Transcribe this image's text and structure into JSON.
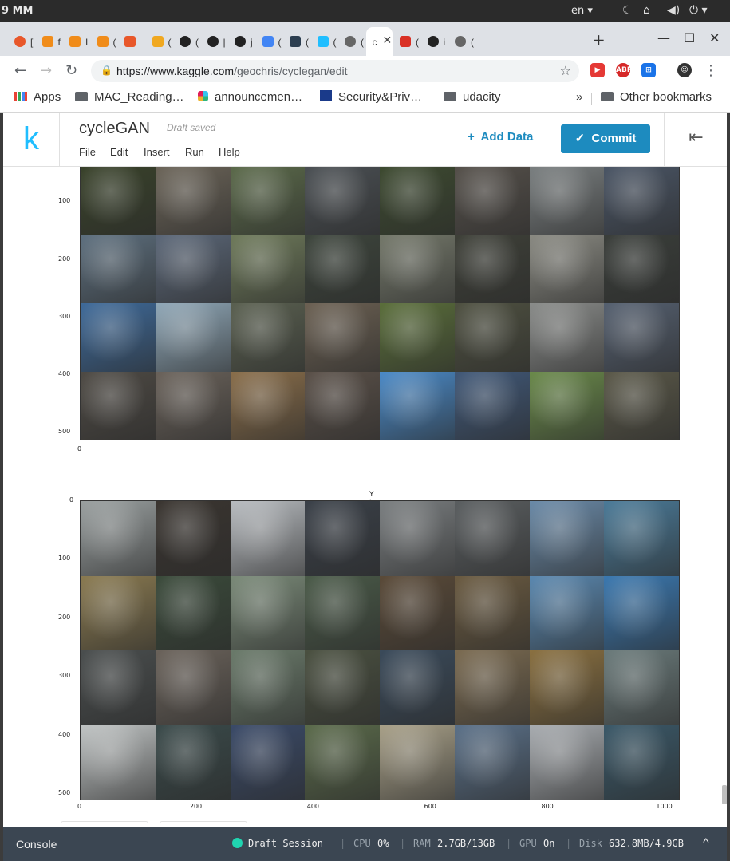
{
  "os": {
    "clock": "9 MM",
    "lang": "en",
    "icons": [
      "moon-icon",
      "network-icon",
      "volume-icon",
      "power-icon"
    ]
  },
  "browser": {
    "tabs": [
      {
        "icon": "chrome-ring-icon",
        "text": "[",
        "color": "#e8572a"
      },
      {
        "icon": "book-icon",
        "text": "f",
        "color": "#f08c1a"
      },
      {
        "icon": "book-icon",
        "text": "I",
        "color": "#f08c1a"
      },
      {
        "icon": "book-icon",
        "text": "(",
        "color": "#f08c1a"
      },
      {
        "icon": "flame-icon",
        "text": "",
        "color": "#e8572a"
      },
      {
        "icon": "infinity-icon",
        "text": "(",
        "color": "#f0a820"
      },
      {
        "icon": "github-icon",
        "text": "(",
        "color": "#222222"
      },
      {
        "icon": "github-icon",
        "text": "|",
        "color": "#222222"
      },
      {
        "icon": "github-icon",
        "text": "j",
        "color": "#222222"
      },
      {
        "icon": "translate-icon",
        "text": "(",
        "color": "#4285f4"
      },
      {
        "icon": "kaggle-dark-icon",
        "text": "(",
        "color": "#2c3e50"
      },
      {
        "icon": "kaggle-icon",
        "text": "(",
        "color": "#20beff"
      },
      {
        "icon": "globe-icon",
        "text": "(",
        "color": "#666666"
      },
      {
        "icon": "active-tab",
        "text": "c",
        "color": "#ffffff"
      },
      {
        "icon": "gmail-icon",
        "text": "(",
        "color": "#d93025"
      },
      {
        "icon": "github-icon",
        "text": "i",
        "color": "#222222"
      },
      {
        "icon": "globe-icon",
        "text": "(",
        "color": "#666666"
      }
    ],
    "url_host": "https://www.kaggle.com",
    "url_path": "/geochris/cyclegan/edit",
    "bookmarks": [
      "Apps",
      "MAC_Reading…",
      "announcemen…",
      "Security&Priv…",
      "udacity"
    ],
    "bookmarks_more": "»",
    "other_bookmarks": "Other bookmarks",
    "extensions": [
      {
        "label": "▶",
        "color": "#e53935"
      },
      {
        "label": "ABP",
        "color": "#d62828"
      },
      {
        "label": "⊞",
        "color": "#1a73e8"
      },
      {
        "label": "☺",
        "color": "#333333"
      }
    ]
  },
  "kaggle": {
    "logo": "k",
    "title": "cycleGAN",
    "status": "Draft saved",
    "menu": [
      "File",
      "Edit",
      "Insert",
      "Run",
      "Help"
    ],
    "add_data": "Add Data",
    "commit": "Commit"
  },
  "plots": [
    {
      "title": "",
      "y_ticks": [
        "100",
        "200",
        "300",
        "400",
        "500"
      ],
      "x_ticks": [
        "0"
      ],
      "grid_colors": [
        "#39422a",
        "#6b6458",
        "#5b6a4a",
        "#4a4f53",
        "#3d4a30",
        "#55504a",
        "#7a7f80",
        "#4a5565",
        "#5d6f7e",
        "#5b6778",
        "#6e7a5a",
        "#3d453c",
        "#74786a",
        "#3e4038",
        "#8a8a82",
        "#3a3e3a",
        "#3e6a9a",
        "#90a8b8",
        "#5a6050",
        "#6b6052",
        "#5a6e3a",
        "#4e5040",
        "#8a8c8a",
        "#556070",
        "#4e4a44",
        "#6a625a",
        "#8a6e4a",
        "#5a5048",
        "#4a8ac8",
        "#405878",
        "#6a8a4a",
        "#5a5848"
      ]
    },
    {
      "title": "Y to X",
      "y_ticks": [
        "0",
        "100",
        "200",
        "300",
        "400",
        "500"
      ],
      "x_ticks": [
        "0",
        "200",
        "400",
        "600",
        "800",
        "1000"
      ],
      "grid_colors": [
        "#9aa0a0",
        "#3a3530",
        "#b8bcc0",
        "#3a4048",
        "#7a7e80",
        "#5a5e60",
        "#6a8aa8",
        "#4a7a98",
        "#8a7a50",
        "#3a4a3a",
        "#7a8a78",
        "#4a5a48",
        "#5a4a38",
        "#6a5a40",
        "#5a88b0",
        "#3a78b0",
        "#4a4e4e",
        "#6a625a",
        "#6a7a6a",
        "#4a5040",
        "#3a4a5a",
        "#7a6a50",
        "#8a7040",
        "#6a7a7a",
        "#c0c4c4",
        "#3a4a4a",
        "#3a4a68",
        "#5a6a4a",
        "#a8a088",
        "#5a7088",
        "#a8acb0",
        "#3a5868"
      ]
    }
  ],
  "console": {
    "label": "Console",
    "session": "Draft Session",
    "cpu_label": "CPU",
    "cpu": "0%",
    "ram_label": "RAM",
    "ram": "2.7GB/13GB",
    "gpu_label": "GPU",
    "gpu": "On",
    "disk_label": "Disk",
    "disk": "632.8MB/4.9GB"
  }
}
